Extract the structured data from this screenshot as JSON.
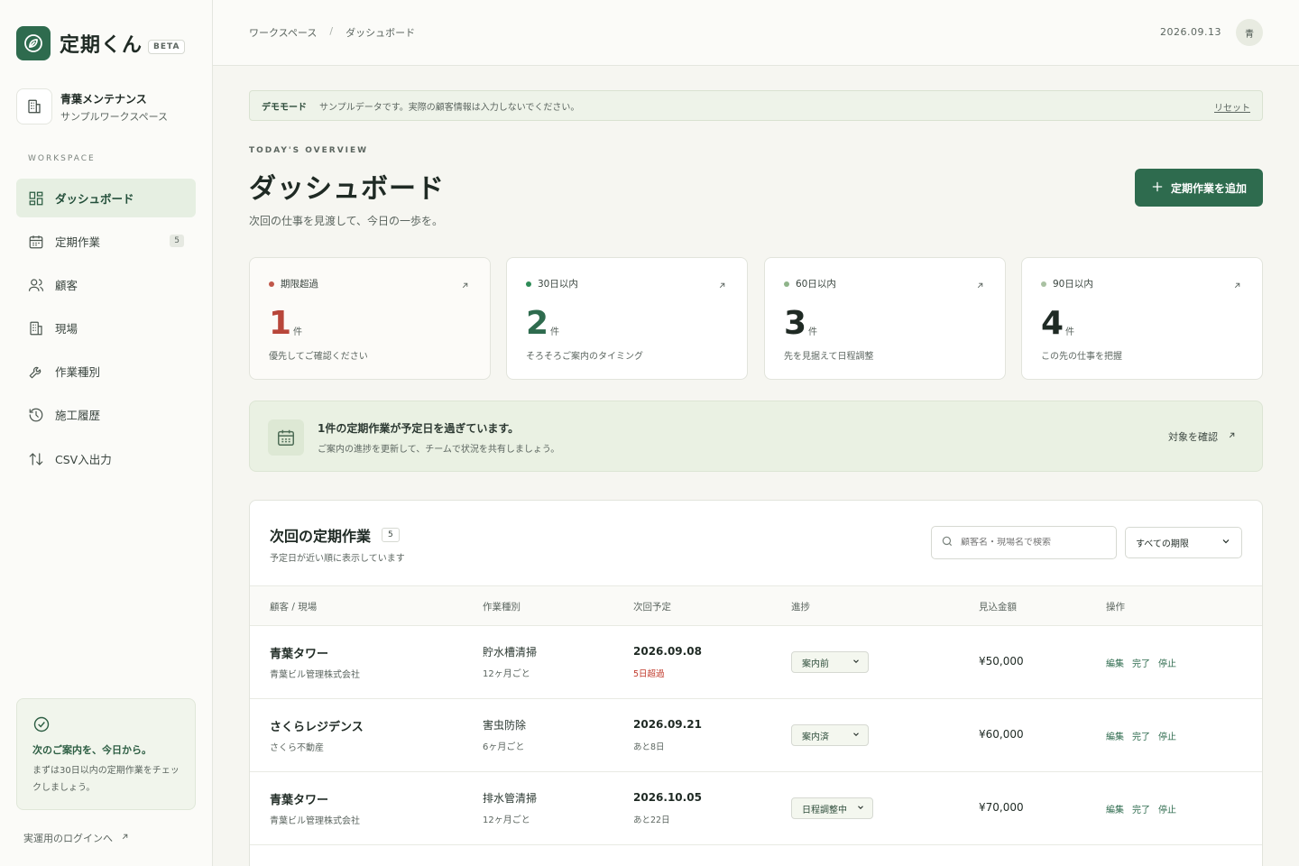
{
  "app": {
    "name": "定期くん",
    "badge": "BETA"
  },
  "workspace": {
    "name": "青葉メンテナンス",
    "subtitle": "サンプルワークスペース"
  },
  "nav": {
    "heading": "WORKSPACE",
    "items": [
      {
        "label": "ダッシュボード",
        "icon": "dashboard-icon",
        "active": true
      },
      {
        "label": "定期作業",
        "icon": "calendar-icon",
        "count": "5"
      },
      {
        "label": "顧客",
        "icon": "users-icon"
      },
      {
        "label": "現場",
        "icon": "building-icon"
      },
      {
        "label": "作業種別",
        "icon": "wrench-icon"
      },
      {
        "label": "施工履歴",
        "icon": "history-icon"
      },
      {
        "label": "CSV入出力",
        "icon": "transfer-icon"
      }
    ]
  },
  "sidebar_tip": {
    "title": "次のご案内を、今日から。",
    "body": "まずは30日以内の定期作業をチェックしましょう。"
  },
  "login_link": "実運用のログインへ",
  "topbar": {
    "breadcrumb": [
      "ワークスペース",
      "ダッシュボード"
    ],
    "separator": "/",
    "date": "2026.09.13",
    "avatar": "青"
  },
  "demo_banner": {
    "label": "デモモード",
    "message": "サンプルデータです。実際の顧客情報は入力しないでください。",
    "reset": "リセット"
  },
  "header": {
    "overline": "TODAY'S OVERVIEW",
    "title": "ダッシュボード",
    "subtitle": "次回の仕事を見渡して、今日の一歩を。",
    "add_button": "定期作業を追加"
  },
  "cards": [
    {
      "label": "期限超過",
      "value": "1",
      "unit": "件",
      "desc": "優先してご確認ください",
      "dot_color": "#c0574a",
      "num_color": "#b8463a"
    },
    {
      "label": "30日以内",
      "value": "2",
      "unit": "件",
      "desc": "そろそろご案内のタイミング",
      "dot_color": "#2e8b57",
      "num_color": "#2e6b4e"
    },
    {
      "label": "60日以内",
      "value": "3",
      "unit": "件",
      "desc": "先を見据えて日程調整",
      "dot_color": "#8fb48a",
      "num_color": "#1f2a24"
    },
    {
      "label": "90日以内",
      "value": "4",
      "unit": "件",
      "desc": "この先の仕事を把握",
      "dot_color": "#a9c1a2",
      "num_color": "#1f2a24"
    }
  ],
  "notice": {
    "title": "1件の定期作業が予定日を過ぎています。",
    "sub": "ご案内の進捗を更新して、チームで状況を共有しましょう。",
    "link": "対象を確認"
  },
  "table": {
    "title": "次回の定期作業",
    "count": "5",
    "subtitle": "予定日が近い順に表示しています",
    "search_placeholder": "顧客名・現場名で検索",
    "filter": "すべての期限",
    "columns": [
      "顧客 / 現場",
      "作業種別",
      "次回予定",
      "進捗",
      "見込金額",
      "操作"
    ],
    "rows": [
      {
        "site": "青葉タワー",
        "company": "青葉ビル管理株式会社",
        "type": "貯水槽清掃",
        "cycle": "12ヶ月ごと",
        "date": "2026.09.08",
        "relative": "5日超過",
        "overdue": true,
        "status": "案内前",
        "amount": "¥50,000",
        "ops": [
          "編集",
          "完了",
          "停止"
        ]
      },
      {
        "site": "さくらレジデンス",
        "company": "さくら不動産",
        "type": "害虫防除",
        "cycle": "6ヶ月ごと",
        "date": "2026.09.21",
        "relative": "あと8日",
        "overdue": false,
        "status": "案内済",
        "amount": "¥60,000",
        "ops": [
          "編集",
          "完了",
          "停止"
        ]
      },
      {
        "site": "青葉タワー",
        "company": "青葉ビル管理株式会社",
        "type": "排水管清掃",
        "cycle": "12ヶ月ごと",
        "date": "2026.10.05",
        "relative": "あと22日",
        "overdue": false,
        "status": "日程調整中",
        "amount": "¥70,000",
        "ops": [
          "編集",
          "完了",
          "停止"
        ]
      }
    ]
  }
}
